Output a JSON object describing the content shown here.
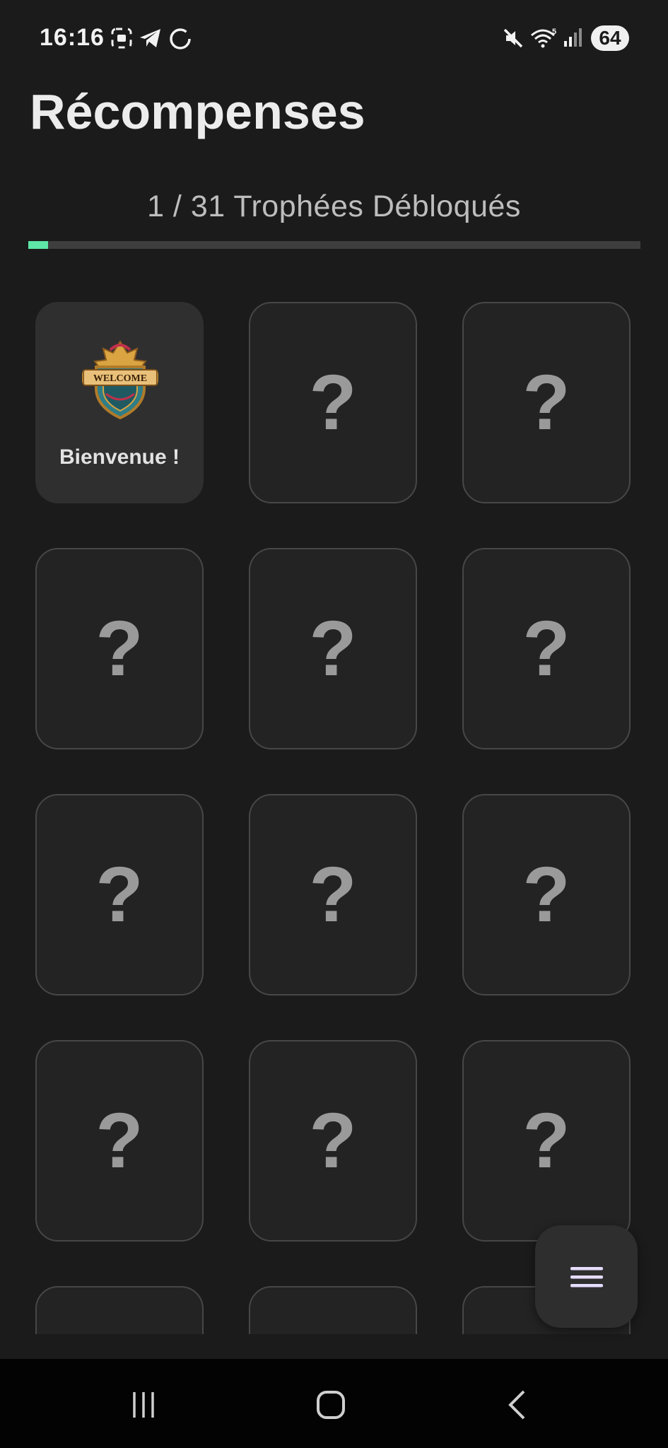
{
  "status_bar": {
    "time": "16:16",
    "battery": "64",
    "icons": [
      "screenshot-icon",
      "telegram-icon",
      "loading-circle-icon",
      "mute-icon",
      "wifi-icon",
      "signal-icon"
    ]
  },
  "page": {
    "title": "Récompenses",
    "progress_text": "1 / 31 Trophées Débloqués",
    "progress": {
      "unlocked": 1,
      "total": 31
    },
    "accent_color": "#5ee6a7"
  },
  "trophies": [
    {
      "label": "Bienvenue !",
      "badge_text": "WELCOME",
      "unlocked": true
    },
    {
      "label": "?",
      "unlocked": false
    },
    {
      "label": "?",
      "unlocked": false
    },
    {
      "label": "?",
      "unlocked": false
    },
    {
      "label": "?",
      "unlocked": false
    },
    {
      "label": "?",
      "unlocked": false
    },
    {
      "label": "?",
      "unlocked": false
    },
    {
      "label": "?",
      "unlocked": false
    },
    {
      "label": "?",
      "unlocked": false
    },
    {
      "label": "?",
      "unlocked": false
    },
    {
      "label": "?",
      "unlocked": false
    },
    {
      "label": "?",
      "unlocked": false
    },
    {
      "label": "?",
      "unlocked": false
    },
    {
      "label": "?",
      "unlocked": false
    },
    {
      "label": "?",
      "unlocked": false
    }
  ],
  "fab": {
    "icon": "menu-icon"
  },
  "nav_bar": {
    "icons": [
      "recent-apps-icon",
      "home-icon",
      "back-icon"
    ]
  }
}
